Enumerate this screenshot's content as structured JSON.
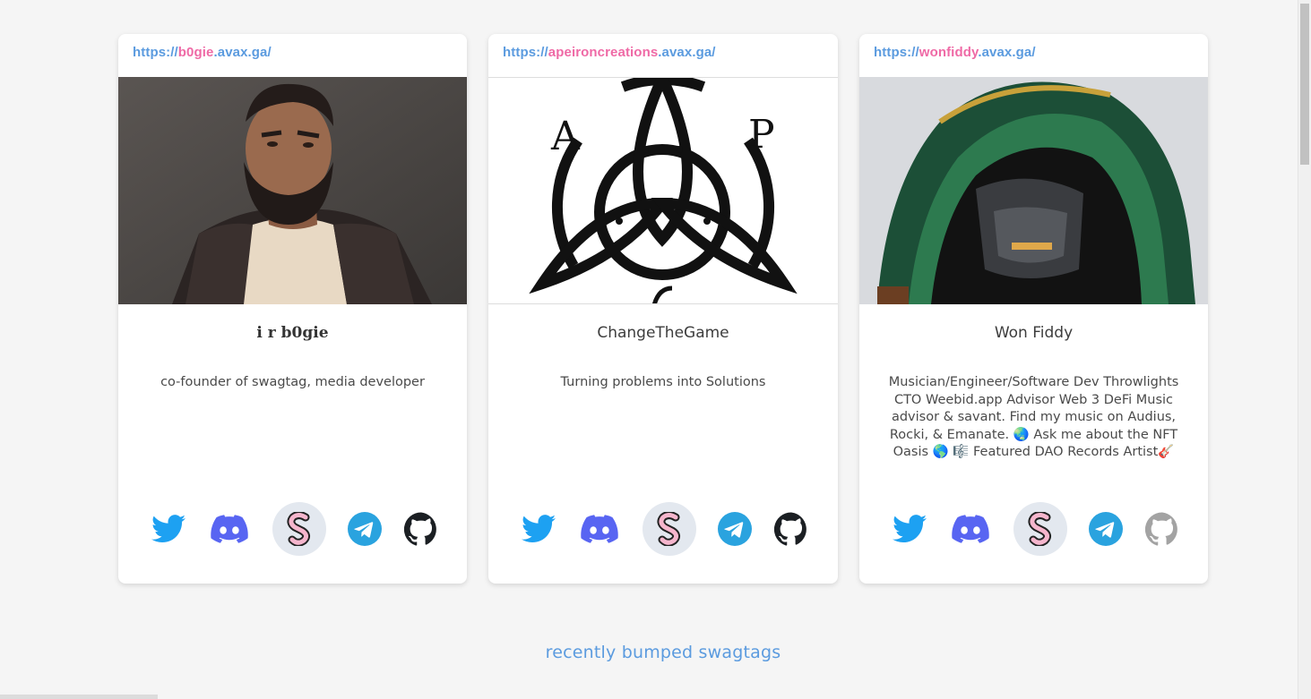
{
  "cards": [
    {
      "url_prefix": "https://",
      "url_name": "b0gie",
      "url_suffix": ".avax.ga/",
      "image": "bearded-avatar",
      "name": "i r b0gie",
      "bio": "co-founder of swagtag, media developer",
      "social": [
        "twitter-icon",
        "discord-icon",
        "swagtag-icon",
        "telegram-icon",
        "github-icon"
      ]
    },
    {
      "url_prefix": "https://",
      "url_name": "apeironcreations",
      "url_suffix": ".avax.ga/",
      "image": "triquetra-logo",
      "name": "ChangeTheGame",
      "bio": "Turning problems into Solutions",
      "social": [
        "twitter-icon",
        "discord-icon",
        "swagtag-icon",
        "telegram-icon",
        "github-icon"
      ]
    },
    {
      "url_prefix": "https://",
      "url_name": "wonfiddy",
      "url_suffix": ".avax.ga/",
      "image": "hooded-mask-photo",
      "name": "Won Fiddy",
      "bio": "Musician/Engineer/Software Dev Throwlights CTO Weebid.app Advisor Web 3 DeFi Music advisor & savant. Find my music on Audius, Rocki, & Emanate. 🌏 Ask me about the NFT Oasis 🌎 🎼 Featured DAO Records Artist🎸",
      "social": [
        "twitter-icon",
        "discord-icon",
        "swagtag-icon",
        "telegram-icon",
        "github-icon"
      ],
      "github_dimmed": true
    }
  ],
  "section_title": "recently bumped swagtags",
  "colors": {
    "url_blue": "#5b9bdf",
    "url_pink": "#ef6aa6",
    "twitter": "#1da1f2",
    "discord": "#5865f2",
    "telegram": "#2aa3df",
    "github": "#1b1f23",
    "swagtag_pink": "#f6b6cd"
  }
}
